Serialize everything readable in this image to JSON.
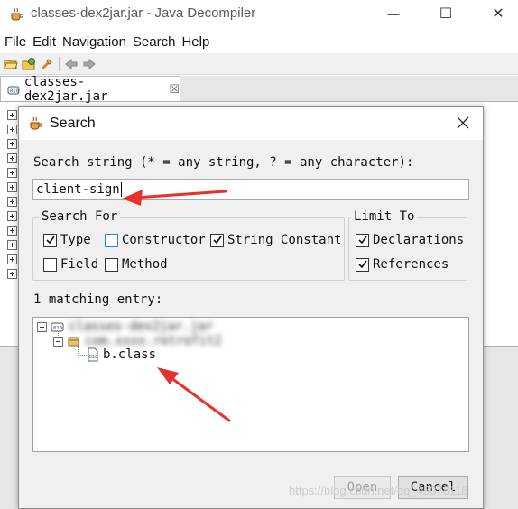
{
  "window": {
    "title": "classes-dex2jar.jar - Java Decompiler",
    "controls": {
      "minimize": "—",
      "maximize": "☐",
      "close": "✕"
    }
  },
  "menu": [
    "File",
    "Edit",
    "Navigation",
    "Search",
    "Help"
  ],
  "toolbar": {
    "icons": [
      "open-file-icon",
      "open-type-icon",
      "search-icon",
      "back-icon",
      "forward-icon"
    ]
  },
  "editor": {
    "tab_label": "classes-dex2jar.jar",
    "tab_close": "☒"
  },
  "dialog": {
    "title": "Search",
    "prompt": "Search string (* = any string, ? = any character):",
    "search_value": "client-sign",
    "search_for": {
      "title": "Search For",
      "options": [
        {
          "label": "Type",
          "checked": true
        },
        {
          "label": "Constructor",
          "checked": false
        },
        {
          "label": "String Constant",
          "checked": true
        },
        {
          "label": "Field",
          "checked": false
        },
        {
          "label": "Method",
          "checked": false
        }
      ]
    },
    "limit_to": {
      "title": "Limit To",
      "options": [
        {
          "label": "Declarations",
          "checked": true
        },
        {
          "label": "References",
          "checked": true
        }
      ]
    },
    "matching": "1 matching entry:",
    "results": {
      "jar_label": "classes-dex2jar.jar",
      "package_label": "com.xxxx.retrofit2",
      "class_label": "b.class"
    },
    "buttons": {
      "open": "Open",
      "cancel": "Cancel"
    }
  },
  "watermark": "https://blog.csdn.net/qq_45078118",
  "colors": {
    "annotation_arrow": "#e8312c",
    "dialog_bg": "#f0f0f0",
    "checkbox_focus": "#3b7fd0"
  }
}
